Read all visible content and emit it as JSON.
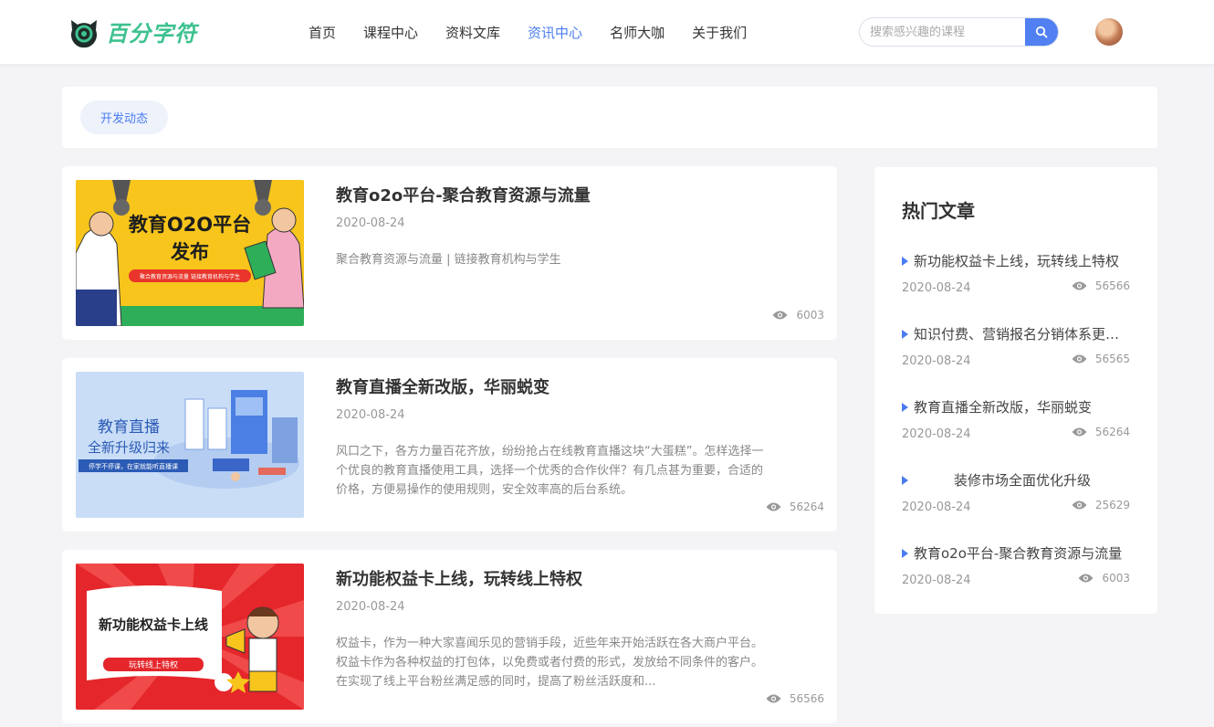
{
  "brand": {
    "name": "百分字符"
  },
  "nav": [
    {
      "label": "首页",
      "active": false
    },
    {
      "label": "课程中心",
      "active": false
    },
    {
      "label": "资料文库",
      "active": false
    },
    {
      "label": "资讯中心",
      "active": true
    },
    {
      "label": "名师大咖",
      "active": false
    },
    {
      "label": "关于我们",
      "active": false
    }
  ],
  "search": {
    "placeholder": "搜索感兴趣的课程"
  },
  "filter": {
    "tag": "开发动态"
  },
  "articles": [
    {
      "title": "教育o2o平台-聚合教育资源与流量",
      "date": "2020-08-24",
      "desc": "聚合教育资源与流量 | 链接教育机构与学生",
      "views": "6003",
      "image": {
        "headline_1": "教育O2O平台",
        "headline_2": "发布",
        "banner": "聚合教育资源与流量 链接教育机构与学生"
      }
    },
    {
      "title": "教育直播全新改版，华丽蜕变",
      "date": "2020-08-24",
      "desc": "风口之下，各方力量百花齐放，纷纷抢占在线教育直播这块“大蛋糕”。怎样选择一个优良的教育直播使用工具，选择一个优秀的合作伙伴？有几点甚为重要，合适的价格，方便易操作的使用规则，安全效率高的后台系统。",
      "views": "56264",
      "image": {
        "headline_1": "教育直播",
        "headline_2": "全新升级归来",
        "banner": "停学不停课，在家就能听直播课"
      }
    },
    {
      "title": "新功能权益卡上线，玩转线上特权",
      "date": "2020-08-24",
      "desc": "权益卡，作为一种大家喜闻乐见的营销手段，近些年来开始活跃在各大商户平台。权益卡作为各种权益的打包体，以免费或者付费的形式，发放给不同条件的客户。在实现了线上平台粉丝满足感的同时，提高了粉丝活跃度和...",
      "views": "56566",
      "image": {
        "headline_1": "新功能权益卡上线",
        "banner": "玩转线上特权"
      }
    }
  ],
  "sidebar": {
    "title": "热门文章",
    "items": [
      {
        "title": "新功能权益卡上线，玩转线上特权",
        "date": "2020-08-24",
        "views": "56566"
      },
      {
        "title": "知识付费、营销报名分销体系更新上线",
        "date": "2020-08-24",
        "views": "56565"
      },
      {
        "title": "教育直播全新改版，华丽蜕变",
        "date": "2020-08-24",
        "views": "56264"
      },
      {
        "title": "装修市场全面优化升级",
        "date": "2020-08-24",
        "views": "25629"
      },
      {
        "title": "教育o2o平台-聚合教育资源与流量",
        "date": "2020-08-24",
        "views": "6003"
      }
    ]
  },
  "colors": {
    "brand": "#3ec28f",
    "accent": "#4a7cf0",
    "background": "#f4f4f6"
  },
  "icons": {
    "search": "search-icon",
    "views": "eye-icon",
    "bullet": "triangle-right-icon",
    "logo": "cat-logo-icon"
  }
}
